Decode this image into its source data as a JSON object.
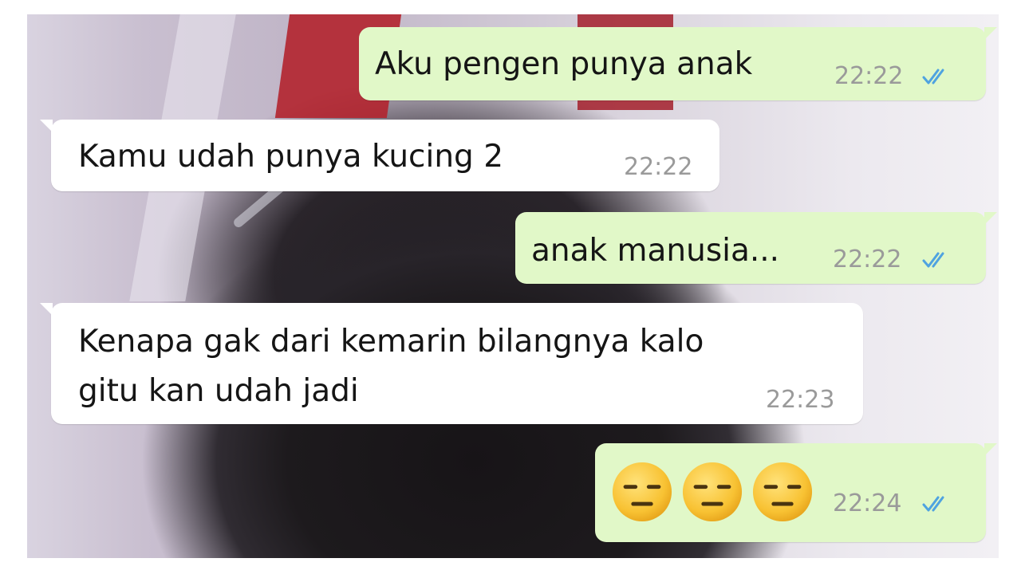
{
  "chat": {
    "messages": [
      {
        "direction": "outgoing",
        "text": "Aku pengen punya anak",
        "time": "22:22",
        "status": "read"
      },
      {
        "direction": "incoming",
        "text": "Kamu udah punya kucing 2",
        "time": "22:22"
      },
      {
        "direction": "outgoing",
        "text": "anak manusia...",
        "time": "22:22",
        "status": "read"
      },
      {
        "direction": "incoming",
        "text_line1": "Kenapa gak dari kemarin bilangnya kalo",
        "text_line2": "gitu kan udah jadi",
        "time": "22:23"
      },
      {
        "direction": "outgoing",
        "emojis": [
          "expressionless-face",
          "expressionless-face",
          "expressionless-face"
        ],
        "time": "22:24",
        "status": "read"
      }
    ]
  },
  "colors": {
    "outgoing_bubble": "#e1f8c8",
    "incoming_bubble": "#ffffff",
    "read_tick": "#4fa3e0",
    "timestamp": "#9a9a9a"
  }
}
